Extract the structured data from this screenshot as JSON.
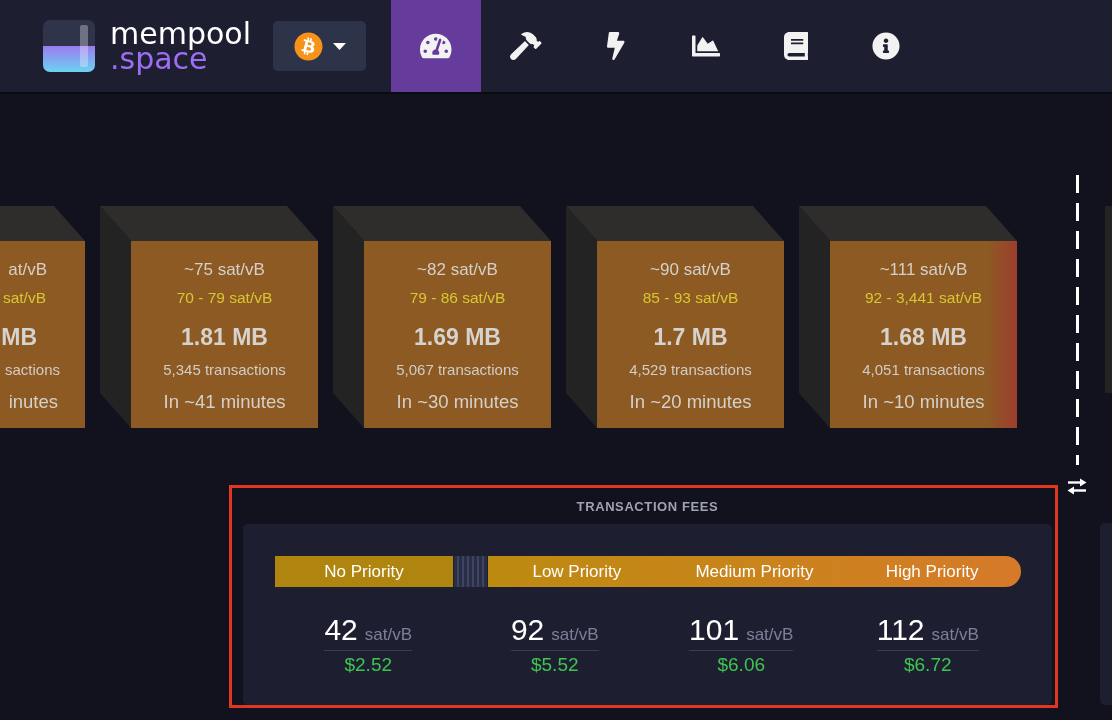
{
  "header": {
    "brand": {
      "name": "mempool",
      "suffix": ".space"
    },
    "nav": [
      {
        "selected": true
      },
      {
        "selected": false
      },
      {
        "selected": false
      },
      {
        "selected": false
      },
      {
        "selected": false
      },
      {
        "selected": false
      }
    ]
  },
  "blocks": [
    {
      "kind": "cut",
      "fee": "at/vB",
      "range": "sat/vB",
      "size": "MB",
      "transactions": "sactions",
      "eta": "inutes",
      "color": "#8d5a23"
    },
    {
      "kind": "full",
      "fee": "~75 sat/vB",
      "range": "70 - 79 sat/vB",
      "size": "1.81 MB",
      "transactions": "5,345 transactions",
      "eta": "In ~41 minutes",
      "color": "#8d5a23"
    },
    {
      "kind": "full",
      "fee": "~82 sat/vB",
      "range": "79 - 86 sat/vB",
      "size": "1.69 MB",
      "transactions": "5,067 transactions",
      "eta": "In ~30 minutes",
      "color": "#8d5a23"
    },
    {
      "kind": "full",
      "fee": "~90 sat/vB",
      "range": "85 - 93 sat/vB",
      "size": "1.7 MB",
      "transactions": "4,529 transactions",
      "eta": "In ~20 minutes",
      "color": "#8d5a23"
    },
    {
      "kind": "full",
      "fee": "~111 sat/vB",
      "range": "92 - 3,441 sat/vB",
      "size": "1.68 MB",
      "transactions": "4,051 transactions",
      "eta": "In ~10 minutes",
      "color": "#9c3e2e"
    }
  ],
  "fees": {
    "title": "TRANSACTION FEES",
    "highlighted": true,
    "priorities": [
      {
        "kind": "none",
        "label": "No Priority",
        "rate": "42",
        "unit": "sat/vB",
        "usd": "$2.52"
      },
      {
        "kind": "tier",
        "label": "Low Priority",
        "rate": "92",
        "unit": "sat/vB",
        "usd": "$5.52"
      },
      {
        "kind": "tier",
        "label": "Medium Priority",
        "rate": "101",
        "unit": "sat/vB",
        "usd": "$6.06"
      },
      {
        "kind": "tier",
        "label": "High Priority",
        "rate": "112",
        "unit": "sat/vB",
        "usd": "$6.72"
      }
    ]
  }
}
